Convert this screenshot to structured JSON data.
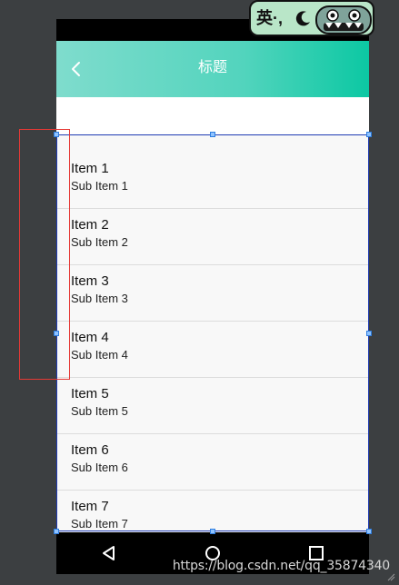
{
  "toolbar": {
    "title": "标题",
    "back_icon": "chevron-left-icon",
    "gradient_start": "#7fdccd",
    "gradient_end": "#0cc8a3"
  },
  "list": {
    "items": [
      {
        "title": "Item 1",
        "subtitle": "Sub Item 1"
      },
      {
        "title": "Item 2",
        "subtitle": "Sub Item 2"
      },
      {
        "title": "Item 3",
        "subtitle": "Sub Item 3"
      },
      {
        "title": "Item 4",
        "subtitle": "Sub Item 4"
      },
      {
        "title": "Item 5",
        "subtitle": "Sub Item 5"
      },
      {
        "title": "Item 6",
        "subtitle": "Sub Item 6"
      },
      {
        "title": "Item 7",
        "subtitle": "Sub Item 7"
      }
    ]
  },
  "nav_bar": {
    "buttons": [
      "back-triangle-icon",
      "home-circle-icon",
      "recents-square-icon"
    ]
  },
  "ime_badge": {
    "text": "英·,"
  },
  "watermark": "https://blog.csdn.net/qq_35874340",
  "colors": {
    "selection_border": "#1f3bb3",
    "handle": "#8fc3ff",
    "highlight_box": "#e53935",
    "workspace": "#3c3f41"
  }
}
